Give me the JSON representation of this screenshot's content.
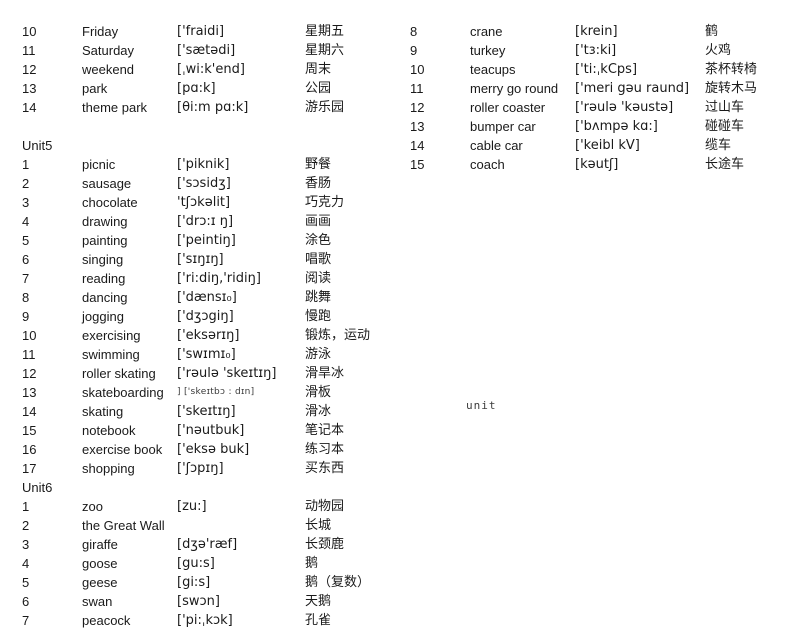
{
  "document": {
    "stray_label": "unit"
  },
  "left_column": {
    "blocks": [
      {
        "type": "rows",
        "rows": [
          {
            "num": "10",
            "word": "Friday",
            "ipa": "['fraidi]",
            "zh": "星期五",
            "ipa_small": false
          },
          {
            "num": "11",
            "word": "Saturday",
            "ipa": "['sætədi]",
            "zh": "星期六",
            "ipa_small": false
          },
          {
            "num": "12",
            "word": "weekend",
            "ipa": "[ˌwi:k'end]",
            "zh": "周末",
            "ipa_small": false
          },
          {
            "num": "13",
            "word": "park",
            "ipa": "[pɑ:k]",
            "zh": "公园",
            "ipa_small": false
          },
          {
            "num": "14",
            "word": "theme park",
            "ipa": "[θi:m pɑ:k]",
            "zh": "游乐园",
            "ipa_small": false
          }
        ]
      },
      {
        "type": "spacer"
      },
      {
        "type": "unit",
        "label": "Unit5"
      },
      {
        "type": "rows",
        "rows": [
          {
            "num": "1",
            "word": "picnic",
            "ipa": "['piknik]",
            "zh": "野餐",
            "ipa_small": false
          },
          {
            "num": "2",
            "word": "sausage",
            "ipa": "['sɔsidʒ]",
            "zh": "香肠",
            "ipa_small": false
          },
          {
            "num": "3",
            "word": "chocolate",
            "ipa": "'tʃɔkəlit]",
            "zh": "巧克力",
            "ipa_small": false
          },
          {
            "num": "4",
            "word": "drawing",
            "ipa": "['drɔ:ɪ ŋ]",
            "zh": "画画",
            "ipa_small": false
          },
          {
            "num": "5",
            "word": "painting",
            "ipa": "['peintiŋ]",
            "zh": "涂色",
            "ipa_small": false
          },
          {
            "num": "6",
            "word": "singing",
            "ipa": "['sɪŋɪŋ]",
            "zh": "唱歌",
            "ipa_small": false
          },
          {
            "num": "7",
            "word": "reading",
            "ipa": "['ri:diŋ,'ridiŋ]",
            "zh": "阅读",
            "ipa_small": false
          },
          {
            "num": "8",
            "word": "dancing",
            "ipa": "['dænsɪ₀]",
            "zh": "跳舞",
            "ipa_small": false
          },
          {
            "num": "9",
            "word": "jogging",
            "ipa": "['dʒɔgiŋ]",
            "zh": "慢跑",
            "ipa_small": false
          },
          {
            "num": "10",
            "word": "exercising",
            "ipa": "['eksərɪŋ]",
            "zh": "锻炼，运动",
            "ipa_small": false
          },
          {
            "num": "11",
            "word": "swimming",
            "ipa": "['swɪmɪ₀]",
            "zh": "游泳",
            "ipa_small": false
          },
          {
            "num": "12",
            "word": "roller skating",
            "ipa": "['rəulə 'skeɪtɪŋ]",
            "zh": "滑旱冰",
            "ipa_small": false
          },
          {
            "num": "13",
            "word": "skateboarding",
            "ipa": "] ['skeɪtbɔ : dɪn]",
            "zh": "滑板",
            "ipa_small": true
          },
          {
            "num": "14",
            "word": "skating",
            "ipa": "['skeɪtɪŋ]",
            "zh": "滑冰",
            "ipa_small": false
          },
          {
            "num": "15",
            "word": "notebook",
            "ipa": "['nəutbuk]",
            "zh": "笔记本",
            "ipa_small": false
          },
          {
            "num": "16",
            "word": "exercise book",
            "ipa": "['eksə buk]",
            "zh": "练习本",
            "ipa_small": false
          },
          {
            "num": "17",
            "word": "shopping",
            "ipa": "['ʃɔpɪŋ]",
            "zh": "买东西",
            "ipa_small": false
          }
        ]
      },
      {
        "type": "unit",
        "label": "Unit6"
      },
      {
        "type": "rows",
        "rows": [
          {
            "num": "1",
            "word": "zoo",
            "ipa": "[zu:]",
            "zh": "动物园",
            "ipa_small": false
          },
          {
            "num": "2",
            "word": "the Great Wall",
            "ipa": "",
            "zh": "长城",
            "ipa_small": false
          },
          {
            "num": "3",
            "word": "giraffe",
            "ipa": "[dʒə'ræf]",
            "zh": "长颈鹿",
            "ipa_small": false
          },
          {
            "num": "4",
            "word": "goose",
            "ipa": "[gu:s]",
            "zh": "鹅",
            "ipa_small": false
          },
          {
            "num": "5",
            "word": "geese",
            "ipa": "[gi:s]",
            "zh": "鹅（复数）",
            "ipa_small": false
          },
          {
            "num": "6",
            "word": "swan",
            "ipa": "[swɔn]",
            "zh": "天鹅",
            "ipa_small": false
          },
          {
            "num": "7",
            "word": "peacock",
            "ipa": "['pi:ˌkɔk]",
            "zh": "孔雀",
            "ipa_small": false
          }
        ]
      }
    ]
  },
  "right_column": {
    "blocks": [
      {
        "type": "rows",
        "rows": [
          {
            "num": "8",
            "word": "crane",
            "ipa": "[krein]",
            "zh": "鹤",
            "ipa_small": false
          },
          {
            "num": "9",
            "word": "turkey",
            "ipa": "['tɜ:ki]",
            "zh": "火鸡",
            "ipa_small": false
          },
          {
            "num": "10",
            "word": "teacups",
            "ipa": "['ti:ˌkCps]",
            "zh": "茶杯转椅",
            "ipa_small": false
          },
          {
            "num": "11",
            "word": "merry go round",
            "ipa": "['meri gəu raund]",
            "zh": "旋转木马",
            "ipa_small": false
          },
          {
            "num": "12",
            "word": "roller coaster",
            "ipa": "['rəulə 'kəustə]",
            "zh": "过山车",
            "ipa_small": false
          },
          {
            "num": "13",
            "word": "bumper car",
            "ipa": "['bʌmpə kɑ:]",
            "zh": "碰碰车",
            "ipa_small": false
          },
          {
            "num": "14",
            "word": "cable car",
            "ipa": "['keibl kV]",
            "zh": "缆车",
            "ipa_small": false
          },
          {
            "num": "15",
            "word": "coach",
            "ipa": "[kəutʃ]",
            "zh": "长途车",
            "ipa_small": false
          }
        ]
      }
    ]
  }
}
